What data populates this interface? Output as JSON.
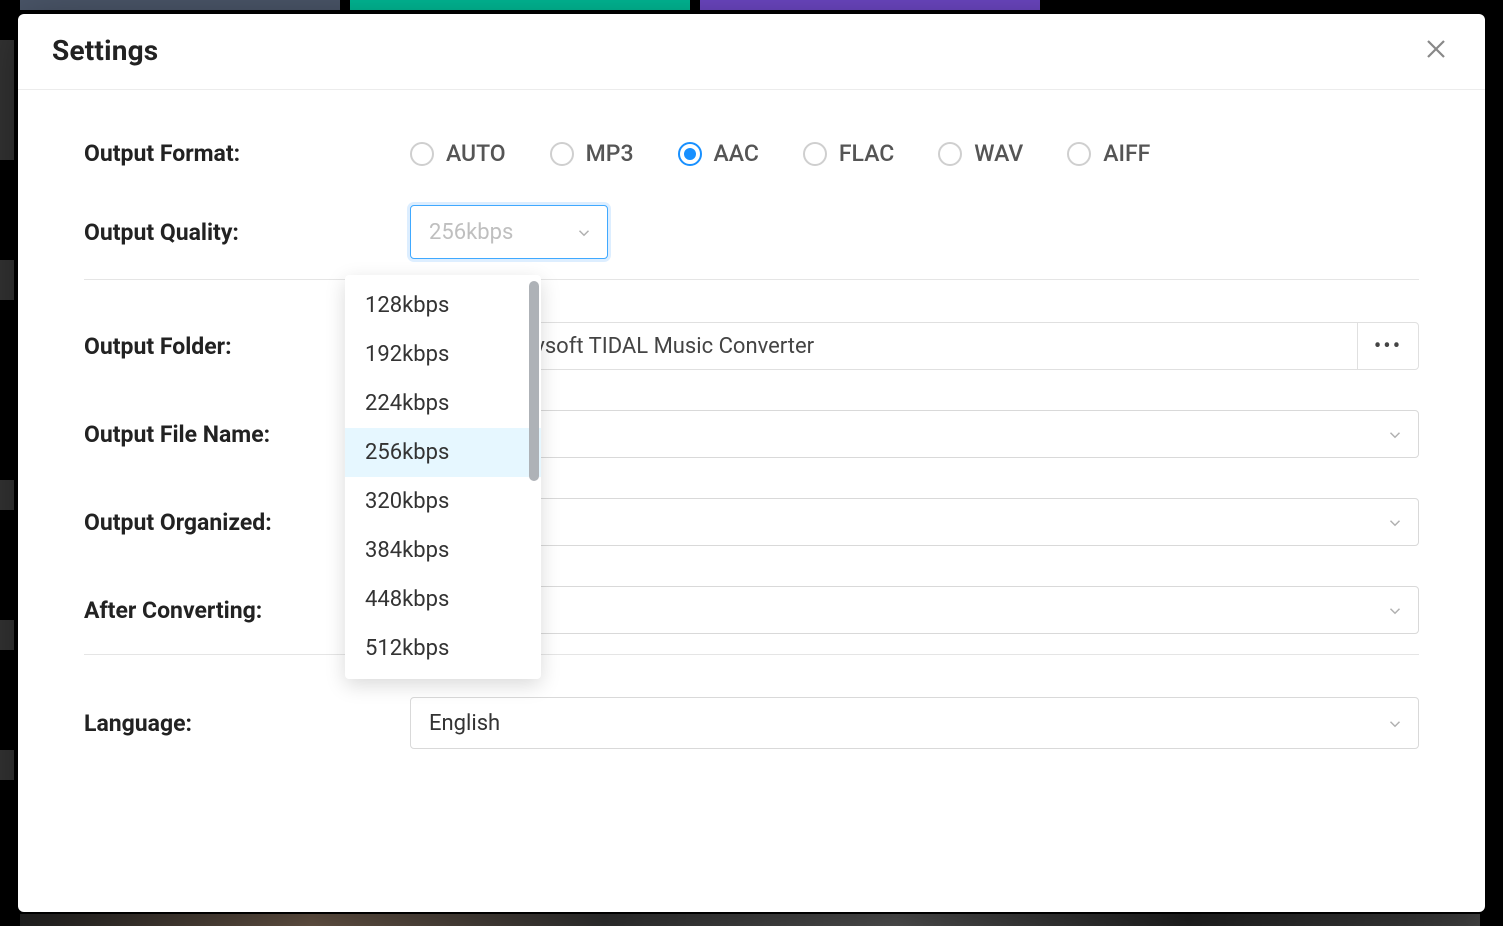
{
  "modal": {
    "title": "Settings"
  },
  "labels": {
    "output_format": "Output Format:",
    "output_quality": "Output Quality:",
    "output_folder": "Output Folder:",
    "output_file_name": "Output File Name:",
    "output_organized": "Output Organized:",
    "after_converting": "After Converting:",
    "language": "Language:"
  },
  "output_format": {
    "options": [
      "AUTO",
      "MP3",
      "AAC",
      "FLAC",
      "WAV",
      "AIFF"
    ],
    "selected": "AAC"
  },
  "output_quality": {
    "selected": "256kbps",
    "options": [
      "128kbps",
      "192kbps",
      "224kbps",
      "256kbps",
      "320kbps",
      "384kbps",
      "448kbps",
      "512kbps"
    ]
  },
  "output_folder": {
    "path": "ments\\Ukeysoft TIDAL Music Converter",
    "browse": "•••"
  },
  "output_file_name": {
    "value": ""
  },
  "output_organized": {
    "value": ""
  },
  "after_converting": {
    "value": ""
  },
  "language": {
    "value": "English"
  }
}
